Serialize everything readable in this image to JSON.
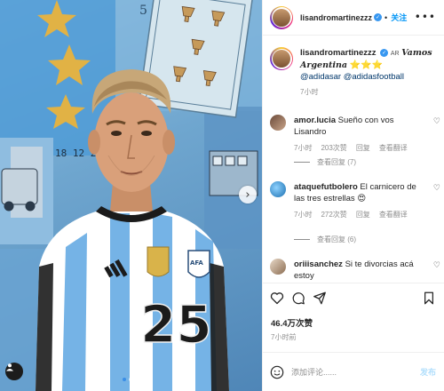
{
  "post": {
    "author": "lisandromartinezzz",
    "follow_label": "关注",
    "more_label": "•••",
    "caption": {
      "flag_text": "AR",
      "text": "Vamos Argentina",
      "stars": "⭐⭐⭐",
      "mention1": "@adidasar",
      "mention2": "@adidasfootball",
      "time": "7小时"
    },
    "image": {
      "jersey_number": "25",
      "card_number": "5",
      "date_stamp": "18 12 2"
    }
  },
  "comments": [
    {
      "user": "amor.lucia",
      "text": "Sueño con vos Lisandro",
      "time": "7小时",
      "likes": "203次赞",
      "reply": "回复",
      "translate": "查看翻译",
      "view_replies": "查看回复 (7)"
    },
    {
      "user": "ataquefutbolero",
      "text": "El carnicero de las tres estrellas",
      "emoji": "😍",
      "time": "7小时",
      "likes": "272次赞",
      "reply": "回复",
      "translate": "查看翻译",
      "view_replies": "查看回复 (6)"
    },
    {
      "user": "oriiisanchez",
      "text": "Si te divorcias acá estoy"
    }
  ],
  "stats": {
    "likes": "46.4万次赞",
    "time": "7小时前"
  },
  "composer": {
    "placeholder": "添加评论......",
    "post_label": "发布"
  },
  "colors": {
    "accent": "#0095f6",
    "sky": "#6fa6cf",
    "jersey_blue": "#75b3e6"
  }
}
